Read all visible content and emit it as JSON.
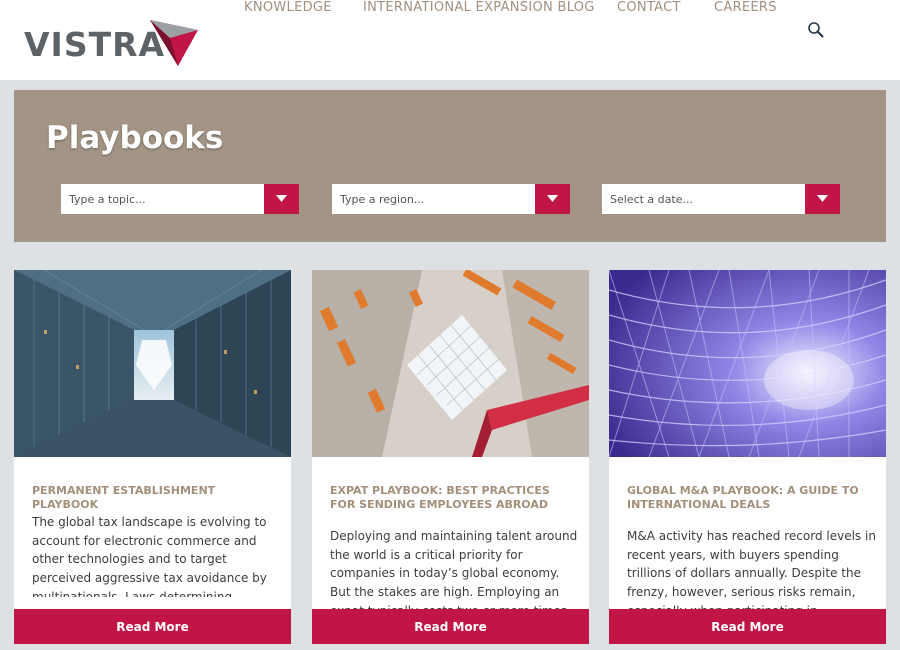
{
  "header": {
    "logo_text": "VISTRA",
    "nav": [
      {
        "label": "KNOWLEDGE"
      },
      {
        "label": "INTERNATIONAL EXPANSION BLOG"
      },
      {
        "label": "CONTACT"
      },
      {
        "label": "CAREERS"
      }
    ],
    "search_icon": "search-icon"
  },
  "hero": {
    "title": "Playbooks",
    "filters": [
      {
        "placeholder": "Type a topic...",
        "icon": "chevron-down-icon"
      },
      {
        "placeholder": "Type a region...",
        "icon": "chevron-down-icon"
      },
      {
        "placeholder": "Select a date...",
        "icon": "chevron-down-icon"
      }
    ]
  },
  "cards": [
    {
      "title": "PERMANENT ESTABLISHMENT PLAYBOOK",
      "excerpt": "The global tax landscape is evolving to account for electronic commerce and other technologies and to target perceived aggressive tax avoidance by multinationals. Laws determining…",
      "button": "Read More"
    },
    {
      "title": "EXPAT PLAYBOOK: BEST PRACTICES FOR SENDING EMPLOYEES ABROAD",
      "excerpt": "Deploying and maintaining talent around the world is a critical priority for companies in today’s global economy. But the stakes are high. Employing an expat typically costs two or more times…",
      "button": "Read More"
    },
    {
      "title": "GLOBAL M&A PLAYBOOK: A GUIDE TO INTERNATIONAL DEALS",
      "excerpt": "M&A activity has reached record levels in recent years, with buyers spending trillions of dollars annually. Despite the frenzy, however, serious risks remain, especially when participating in…",
      "button": "Read More"
    }
  ],
  "colors": {
    "brand_red": "#c01545",
    "hero_bg": "#a39485",
    "nav_text": "#a1907f",
    "page_bg": "#dde1e4"
  }
}
